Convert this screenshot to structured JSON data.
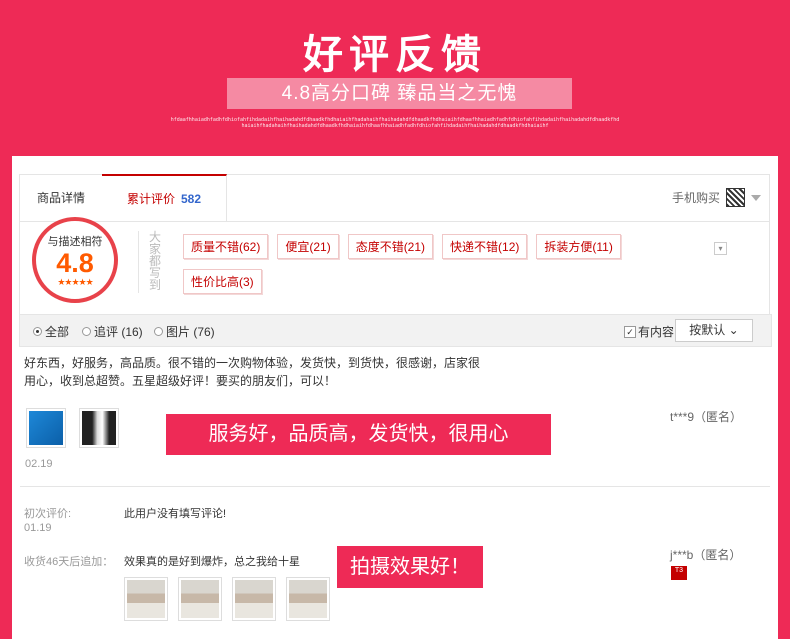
{
  "hero": {
    "title": "好评反馈",
    "subtitle": "4.8高分口碑 臻品当之无愧",
    "deco_text": "hfdaafhhaiadhfadhfdhiofahfihdadaihfhaihadahdfdhaadkfhdhaiaihfhadahaihfhaihadahdfdhaadkfhdhaiaihfdhaafhhaiadhfadhfdhiofahfihdadaihfhaihadahdfdhaadkfhdhaiaihfhadahaihfhaihadahdfdhaadkfhdhaiaihfdhaafhhaiadhfadhfdhiofahfihdadaihfhaihadahdfdhaadkfhdhaiaihf"
  },
  "tabs": {
    "detail_label": "商品详情",
    "reviews_label": "累计评价",
    "reviews_count": "582",
    "mobile_label": "手机购买"
  },
  "score": {
    "label": "与描述相符",
    "value": "4.8",
    "stars": "★★★★★",
    "vertical_text": "大家都写到"
  },
  "tags": [
    "质量不错(62)",
    "便宜(21)",
    "态度不错(21)",
    "快递不错(12)",
    "拆装方便(11)",
    "性价比高(3)"
  ],
  "filter": {
    "all": "全部",
    "followup": "追评 (16)",
    "images": "图片 (76)",
    "has_content": "有内容",
    "sort": "按默认 ⌄"
  },
  "review1": {
    "text": "好东西，好服务，高品质。很不错的一次购物体验，发货快，到货快，很感谢，店家很用心，收到总超赞。五星超级好评！要买的朋友们，可以！",
    "date": "02.19",
    "user": "t***9（匿名）",
    "banner": "服务好，品质高，发货快，很用心"
  },
  "review2": {
    "initial_label": "初次评价:",
    "initial_date": "01.19",
    "initial_text": "此用户没有填写评论!",
    "followup_label": "收货46天后追加：",
    "followup_text": "效果真的是好到爆炸，总之我给十星",
    "user": "j***b（匿名）",
    "banner": "拍摄效果好！",
    "badge": "T3"
  },
  "colors": {
    "brand": "#ee2a56",
    "accent": "#c40000",
    "score": "#ff5a00"
  }
}
